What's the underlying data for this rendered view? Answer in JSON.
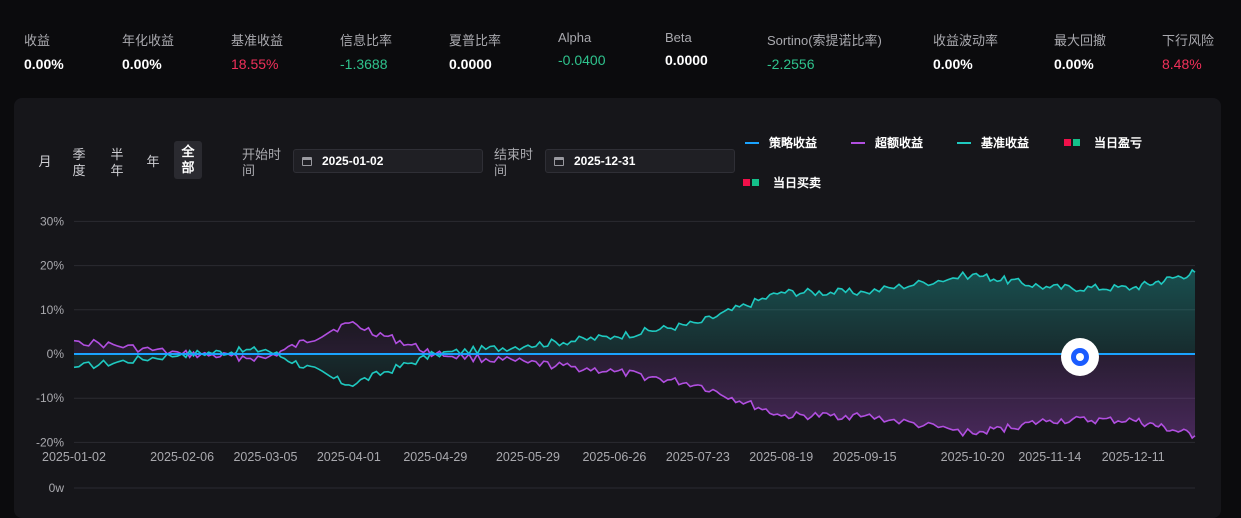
{
  "metrics": [
    {
      "label": "收益",
      "value": "0.00%",
      "tone": "white"
    },
    {
      "label": "年化收益",
      "value": "0.00%",
      "tone": "white"
    },
    {
      "label": "基准收益",
      "value": "18.55%",
      "tone": "red"
    },
    {
      "label": "信息比率",
      "value": "-1.3688",
      "tone": "green"
    },
    {
      "label": "夏普比率",
      "value": "0.0000",
      "tone": "white"
    },
    {
      "label": "Alpha",
      "value": "-0.0400",
      "tone": "green"
    },
    {
      "label": "Beta",
      "value": "0.0000",
      "tone": "white"
    },
    {
      "label": "Sortino(索提诺比率)",
      "value": "-2.2556",
      "tone": "green"
    },
    {
      "label": "收益波动率",
      "value": "0.00%",
      "tone": "white"
    },
    {
      "label": "最大回撤",
      "value": "0.00%",
      "tone": "white"
    },
    {
      "label": "下行风险",
      "value": "8.48%",
      "tone": "red"
    }
  ],
  "periods": [
    "月",
    "季度",
    "半年",
    "年",
    "全部"
  ],
  "active_period": "全部",
  "start": {
    "label": "开始时间",
    "value": "2025-01-02"
  },
  "end": {
    "label": "结束时间",
    "value": "2025-12-31"
  },
  "legend": {
    "strategy": "策略收益",
    "excess": "超额收益",
    "benchmark": "基准收益",
    "daily_pnl": "当日盈亏",
    "daily_trade": "当日买卖"
  },
  "colors": {
    "strategy": "#1aa3ff",
    "excess": "#b14fe0",
    "benchmark": "#1fc9c0",
    "up": "#f0104a",
    "down": "#14c08a"
  },
  "chart_data": {
    "type": "line",
    "x": [
      "2025-01-02",
      "2025-02-06",
      "2025-03-05",
      "2025-04-01",
      "2025-04-29",
      "2025-05-29",
      "2025-06-26",
      "2025-07-23",
      "2025-08-19",
      "2025-09-15",
      "2025-10-20",
      "2025-11-14",
      "2025-12-11",
      "2025-12-31"
    ],
    "xticks": [
      "2025-01-02",
      "2025-02-06",
      "2025-03-05",
      "2025-04-01",
      "2025-04-29",
      "2025-05-29",
      "2025-06-26",
      "2025-07-23",
      "2025-08-19",
      "2025-09-15",
      "2025-10-20",
      "2025-11-14",
      "2025-12-11"
    ],
    "yticks": [
      "30%",
      "20%",
      "10%",
      "0%",
      "-10%",
      "-20%"
    ],
    "ylim": [
      -20,
      30
    ],
    "volume_tick": "0w",
    "series": [
      {
        "name": "策略收益",
        "values": [
          0,
          0,
          0,
          0,
          0,
          0,
          0,
          0,
          0,
          0,
          0,
          0,
          0,
          0
        ]
      },
      {
        "name": "超额收益",
        "values": [
          3,
          0,
          -1,
          7,
          0,
          -2,
          -4,
          -7,
          -14,
          -14,
          -17,
          -15,
          -15,
          -17
        ]
      },
      {
        "name": "基准收益",
        "values": [
          -3,
          0,
          1,
          -7,
          0,
          2,
          4,
          7,
          14,
          14,
          18,
          15,
          15,
          18.5
        ]
      }
    ]
  }
}
